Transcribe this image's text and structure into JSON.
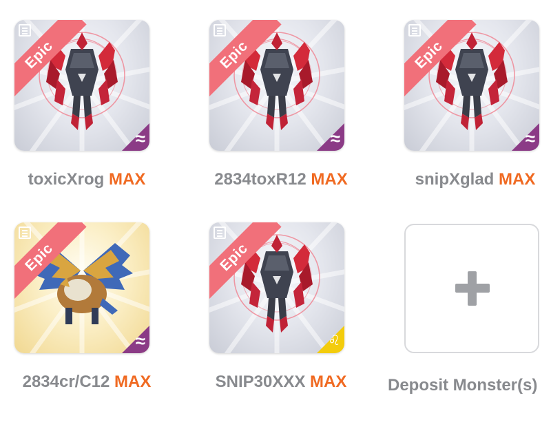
{
  "colors": {
    "epic_ribbon": "#f1707a",
    "level_orange": "#f06a22",
    "caption_gray": "#888a8e",
    "water_badge": "#8b3b86",
    "light_badge": "#f3cc0c"
  },
  "slots": [
    {
      "rarity": "Epic",
      "name": "toxicXrog",
      "level": "MAX",
      "element_icon": "wave-icon",
      "element_symbol": "≈",
      "monster": "red-crystal-monster"
    },
    {
      "rarity": "Epic",
      "name": "2834toxR12",
      "level": "MAX",
      "element_icon": "wave-icon",
      "element_symbol": "≈",
      "monster": "red-crystal-monster"
    },
    {
      "rarity": "Epic",
      "name": "snipXglad",
      "level": "MAX",
      "element_icon": "wave-icon",
      "element_symbol": "≈",
      "monster": "red-crystal-monster"
    },
    {
      "rarity": "Epic",
      "name": "2834cr/C12",
      "level": "MAX",
      "element_icon": "wave-icon",
      "element_symbol": "≈",
      "monster": "blue-winged-griffin"
    },
    {
      "rarity": "Epic",
      "name": "SNIP30XXX",
      "level": "MAX",
      "element_icon": "leo-icon",
      "element_symbol": "♌",
      "monster": "red-crystal-monster"
    }
  ],
  "deposit": {
    "label": "Deposit Monster(s)",
    "icon": "plus-icon"
  }
}
